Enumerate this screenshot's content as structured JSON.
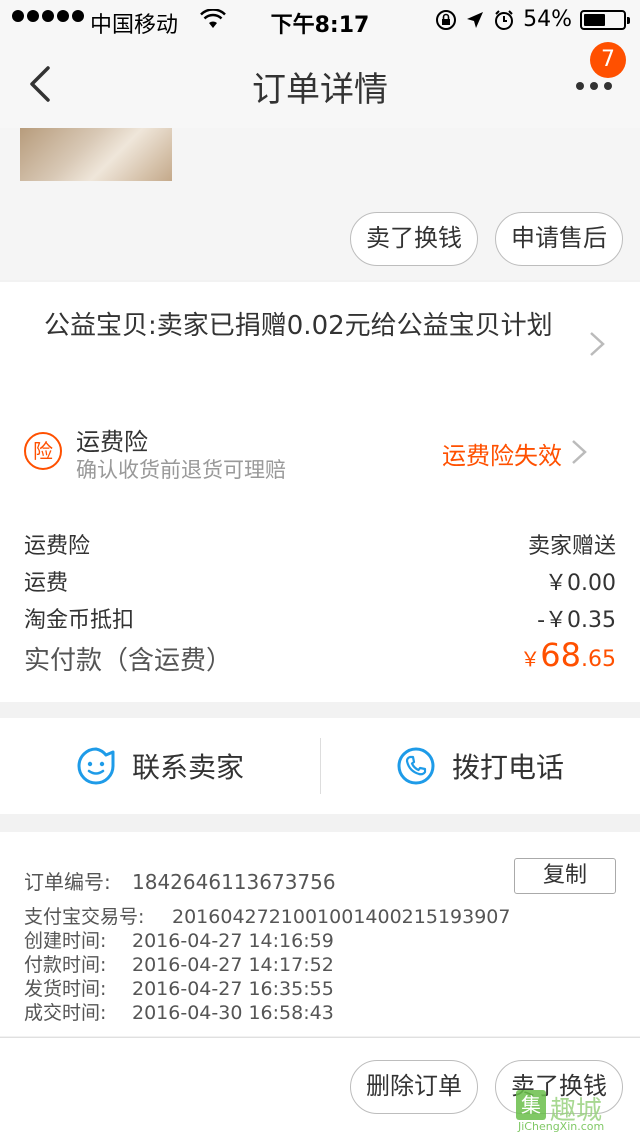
{
  "status_bar": {
    "carrier": "中国移动",
    "time": "下午8:17",
    "battery": "54%",
    "battery_level": 0.54
  },
  "nav": {
    "title": "订单详情",
    "badge": "7"
  },
  "top_actions": {
    "sell": "卖了换钱",
    "after_sale": "申请售后"
  },
  "charity": {
    "text": "公益宝贝:卖家已捐赠0.02元给公益宝贝计划"
  },
  "insurance": {
    "icon_char": "险",
    "title": "运费险",
    "subtitle": "确认收货前退货可理赔",
    "status": "运费险失效"
  },
  "fees": [
    {
      "label": "运费险",
      "value": "卖家赠送"
    },
    {
      "label": "运费",
      "value": "￥0.00"
    },
    {
      "label": "淘金币抵扣",
      "value": "-￥0.35"
    }
  ],
  "total": {
    "label": "实付款（含运费）",
    "currency": "￥",
    "integer": "68",
    "decimal": ".65"
  },
  "contact": {
    "seller": "联系卖家",
    "phone": "拨打电话"
  },
  "order_info": {
    "copy": "复制",
    "lines": [
      {
        "key": "订单编号:",
        "value": "1842646113673756"
      },
      {
        "key": "支付宝交易号:",
        "value": "2016042721001001400215193907"
      },
      {
        "key": "创建时间:",
        "value": "2016-04-27 14:16:59"
      },
      {
        "key": "付款时间:",
        "value": "2016-04-27 14:17:52"
      },
      {
        "key": "发货时间:",
        "value": "2016-04-27 16:35:55"
      },
      {
        "key": "成交时间:",
        "value": "2016-04-30 16:58:43"
      }
    ]
  },
  "bottom_actions": {
    "delete": "删除订单",
    "sell": "卖了换钱"
  },
  "watermark": {
    "logo_char": "集",
    "cn": "趣城",
    "en": "JiChengXin.com"
  },
  "colors": {
    "accent": "#ff5000",
    "contact_icon": "#1e9be8"
  }
}
